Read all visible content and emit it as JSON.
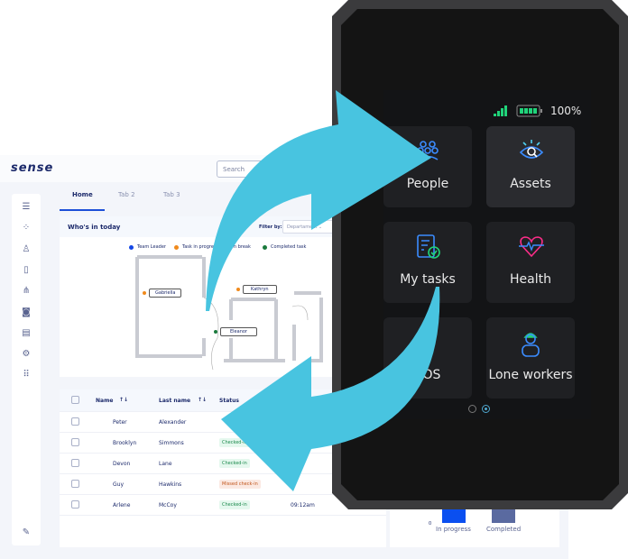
{
  "app": {
    "logo": "sense",
    "search_placeholder": "Search"
  },
  "tabs": [
    {
      "label": "Home",
      "active": true
    },
    {
      "label": "Tab 2"
    },
    {
      "label": "Tab 3"
    }
  ],
  "sidebar": {
    "icons": [
      "menu-icon",
      "dashboard-icon",
      "user-icon",
      "tablet-icon",
      "org-chart-icon",
      "camera-folder-icon",
      "report-icon",
      "settings-icon",
      "apps-grid-icon",
      "edit-icon"
    ]
  },
  "whos_in": {
    "title": "Who's in today",
    "filter_label": "Filter by:",
    "filter_value": "Departament",
    "legend": [
      {
        "label": "Team Leader",
        "color": "#1447e6"
      },
      {
        "label": "Task in progress",
        "color": "#f08a1c"
      },
      {
        "label": "On break",
        "color": "#888"
      },
      {
        "label": "Completed task",
        "color": "#1a7a3c"
      }
    ],
    "people": [
      {
        "name": "Gabriella",
        "status_color": "#f08a1c"
      },
      {
        "name": "Kathryn",
        "status_color": "#f08a1c"
      },
      {
        "name": "Eleanor",
        "status_color": "#1a7a3c"
      }
    ]
  },
  "table": {
    "headers": [
      "Name",
      "Last name",
      "Status"
    ],
    "rows": [
      {
        "name": "Peter",
        "last": "Alexander",
        "status": "",
        "status_type": "",
        "time": ""
      },
      {
        "name": "Brooklyn",
        "last": "Simmons",
        "status": "Checked-in",
        "status_type": "ok",
        "time": ""
      },
      {
        "name": "Devon",
        "last": "Lane",
        "status": "Checked-in",
        "status_type": "ok",
        "time": ""
      },
      {
        "name": "Guy",
        "last": "Hawkins",
        "status": "Missed check-in",
        "status_type": "miss",
        "time": ""
      },
      {
        "name": "Arlene",
        "last": "McCoy",
        "status": "Checked-in",
        "status_type": "ok",
        "time": "09:12am"
      }
    ]
  },
  "mini_chart": {
    "y_tick": "0",
    "categories": [
      "In progress",
      "Completed"
    ],
    "colors": [
      "#0a4ff0",
      "#5a6aa0"
    ]
  },
  "device": {
    "battery": "100%",
    "tiles": [
      "People",
      "Assets",
      "My tasks",
      "Health",
      "SOS",
      "Lone workers"
    ],
    "page_count": 2,
    "active_page": 2
  },
  "accent": "#48c4e0"
}
